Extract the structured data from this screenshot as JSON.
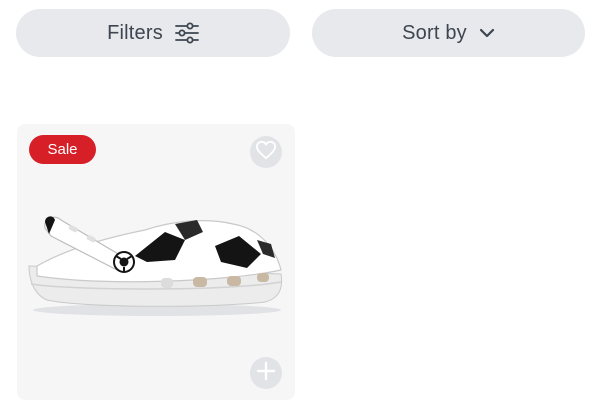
{
  "toolbar": {
    "filters_label": "Filters",
    "filters_icon": "sliders-icon",
    "sort_label": "Sort by",
    "sort_icon": "chevron-down-icon"
  },
  "product_card": {
    "badge": "Sale",
    "favorite_icon": "heart-icon",
    "add_icon": "plus-icon",
    "image_subject": "white clog with black soccer-ball panels",
    "badge_color": "#d61f26"
  }
}
